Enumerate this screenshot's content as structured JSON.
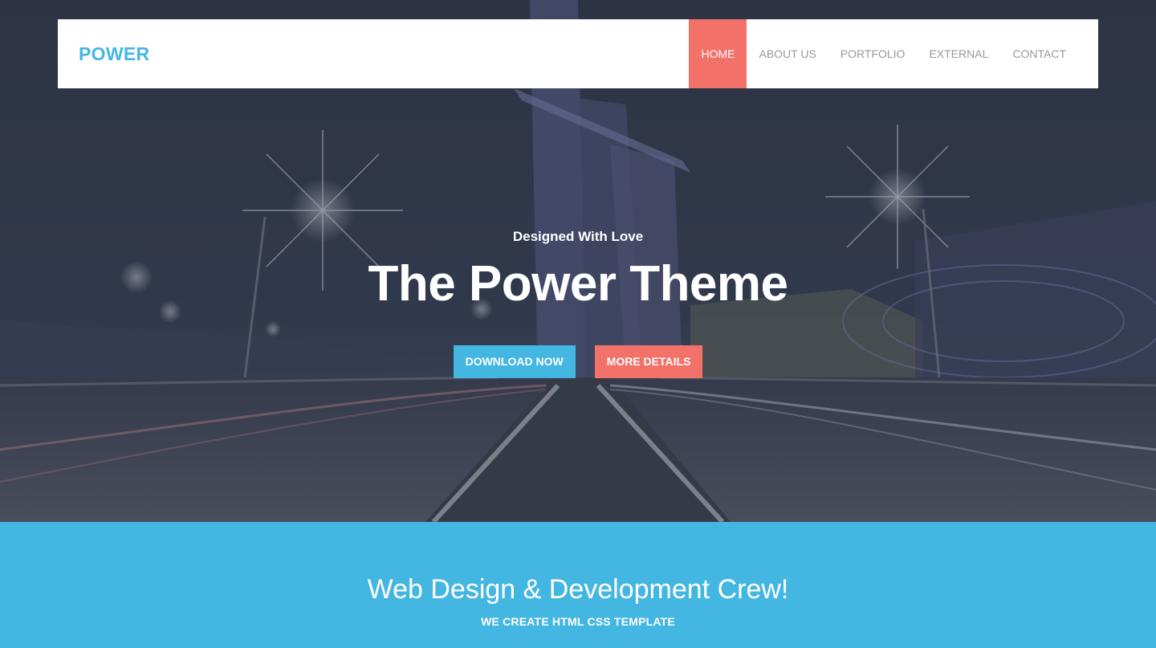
{
  "brand": {
    "name": "POWER"
  },
  "nav": {
    "items": [
      {
        "label": "HOME",
        "active": true
      },
      {
        "label": "ABOUT US",
        "active": false
      },
      {
        "label": "PORTFOLIO",
        "active": false
      },
      {
        "label": "EXTERNAL",
        "active": false
      },
      {
        "label": "CONTACT",
        "active": false
      }
    ]
  },
  "hero": {
    "subtitle": "Designed With Love",
    "title": "The Power Theme",
    "buttons": {
      "download": "DOWNLOAD NOW",
      "details": "MORE DETAILS"
    },
    "background": "city-night-road-light-trails-image"
  },
  "band": {
    "title": "Web Design & Development Crew!",
    "subtitle": "WE CREATE HTML CSS TEMPLATE"
  },
  "colors": {
    "accent_blue": "#44b6e2",
    "accent_red": "#f27169",
    "nav_text": "#999999",
    "hero_dark": "#2f3848",
    "white": "#ffffff"
  }
}
